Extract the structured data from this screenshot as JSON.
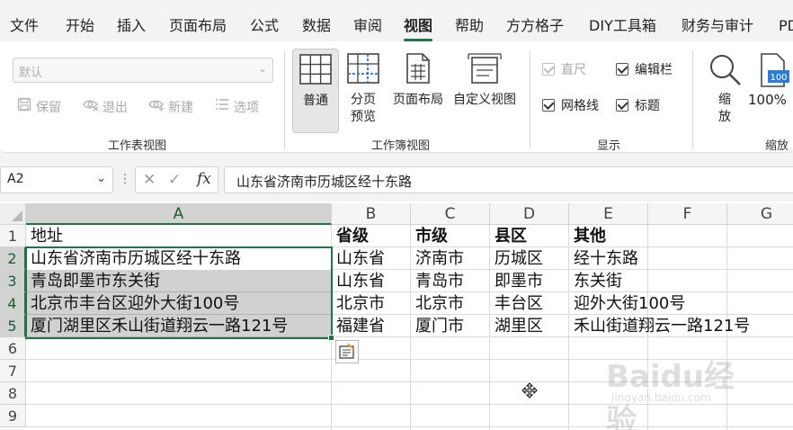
{
  "ribbon_tabs": [
    "文件",
    "开始",
    "插入",
    "页面布局",
    "公式",
    "数据",
    "审阅",
    "视图",
    "帮助",
    "方方格子",
    "DIY工具箱",
    "财务与审计",
    "PD"
  ],
  "active_tab": "视图",
  "ribbon": {
    "workbook_view_group": {
      "combo_value": "默认",
      "keep": "保留",
      "exit": "退出",
      "new": "新建",
      "options": "选项",
      "label": "工作表视图"
    },
    "workbook_views": {
      "normal": "普通",
      "page_break_1": "分页",
      "page_break_2": "预览",
      "page_layout": "页面布局",
      "custom_view": "自定义视图",
      "label": "工作簿视图"
    },
    "show": {
      "ruler": "直尺",
      "formula_bar": "编辑栏",
      "gridlines": "网格线",
      "headings": "标题",
      "label": "显示",
      "ruler_checked": true,
      "formula_bar_checked": true,
      "gridlines_checked": true,
      "headings_checked": true
    },
    "zoom": {
      "zoom_1": "缩",
      "zoom_2": "放",
      "zoom100": "100%",
      "zoom100_badge": "100",
      "label": "缩放"
    }
  },
  "formula_bar": {
    "name_box": "A2",
    "fx": "fx",
    "content": "山东省济南市历城区经十东路"
  },
  "sheet": {
    "columns": [
      "A",
      "B",
      "C",
      "D",
      "E",
      "F",
      "G"
    ],
    "rows": [
      "1",
      "2",
      "3",
      "4",
      "5",
      "6",
      "7",
      "8",
      "9"
    ],
    "cells": [
      [
        "地址",
        "省级",
        "市级",
        "县区",
        "其他"
      ],
      [
        "山东省济南市历城区经十东路",
        "山东省",
        "济南市",
        "历城区",
        "经十东路"
      ],
      [
        "青岛即墨市东关街",
        "山东省",
        "青岛市",
        "即墨市",
        "东关街"
      ],
      [
        "北京市丰台区迎外大街100号",
        "北京市",
        "北京市",
        "丰台区",
        "迎外大街100号"
      ],
      [
        "厦门湖里区禾山街道翔云一路121号",
        "福建省",
        "厦门市",
        "湖里区",
        "禾山街道翔云一路121号"
      ]
    ],
    "selected_range": "A2:A5",
    "active_cell": "A2"
  },
  "watermark": {
    "text": "Baidu经验",
    "sub": "jingyan.baidu.com"
  },
  "colors": {
    "accent": "#217346",
    "ribbon_bg": "#f3f3f3",
    "selection_fill": "#d2d2d2"
  }
}
